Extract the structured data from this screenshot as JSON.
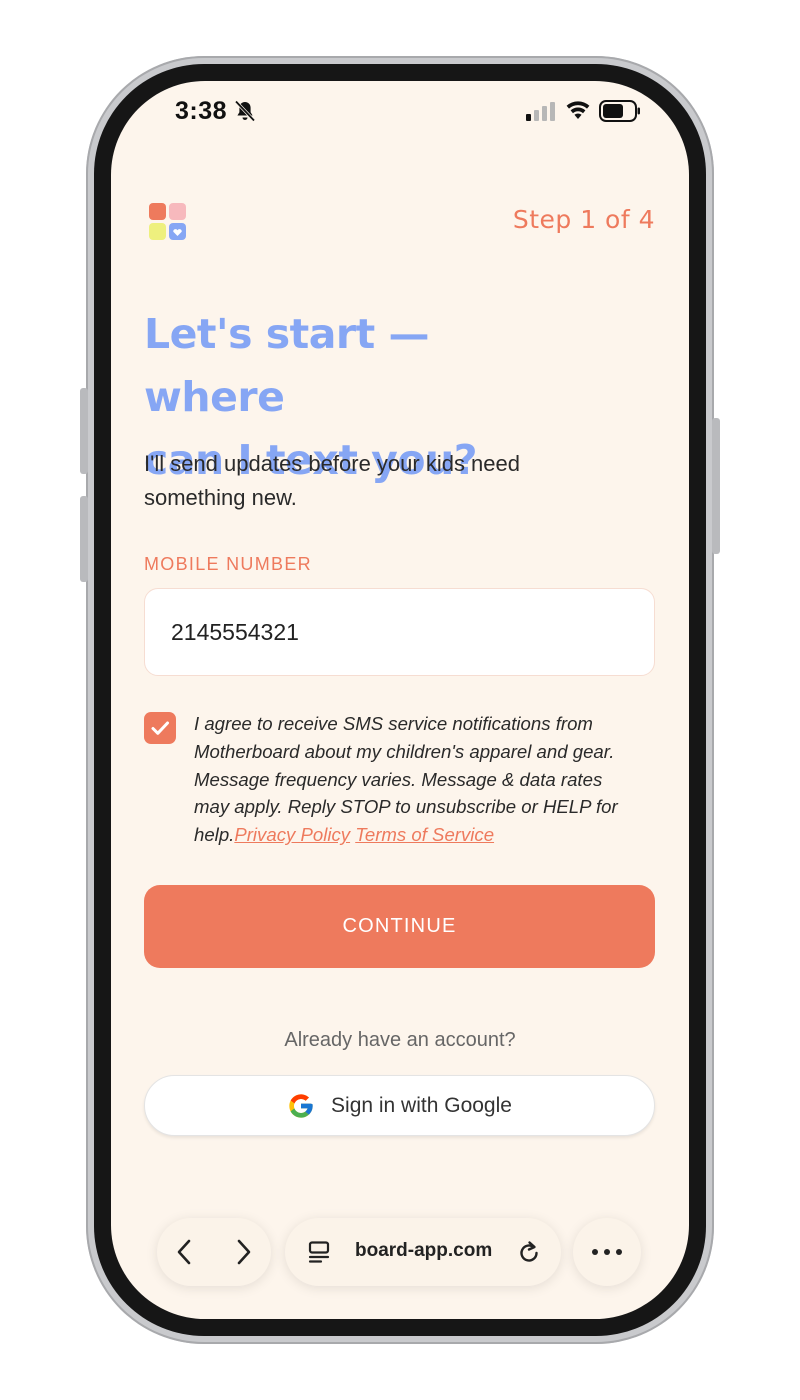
{
  "status_bar": {
    "time": "3:38",
    "icons": [
      "bell-muted-icon",
      "signal-icon",
      "wifi-icon",
      "battery-icon"
    ]
  },
  "header": {
    "logo": "app-logo-icon",
    "step": "Step 1 of 4"
  },
  "main": {
    "headline_line1": "Let's start — where",
    "headline_line2": "can I text you?",
    "subtext_line1": "I'll send updates before your kids need",
    "subtext_line2": "something new.",
    "field_label": "MOBILE NUMBER",
    "phone_value": "2145554321",
    "consent_checked": true,
    "consent_line1": "I agree to receive SMS service notifications from",
    "consent_line2": "Motherboard about my children's apparel and gear.",
    "consent_line3": "Message frequency varies. Message & data rates",
    "consent_line4": "may apply. Reply STOP to unsubscribe or HELP for",
    "consent_line5": "help.",
    "privacy_link": "Privacy Policy",
    "terms_link": "Terms of Service",
    "continue_label": "CONTINUE",
    "already_text": "Already have an account?",
    "google_label": "Sign in with Google"
  },
  "browser": {
    "url": "board-app.com",
    "icons": [
      "back-icon",
      "forward-icon",
      "tab-icon",
      "reload-icon",
      "more-icon"
    ]
  },
  "colors": {
    "accent": "#ee7a5d",
    "headline": "#86a6f4",
    "background": "#fdf5ec"
  }
}
